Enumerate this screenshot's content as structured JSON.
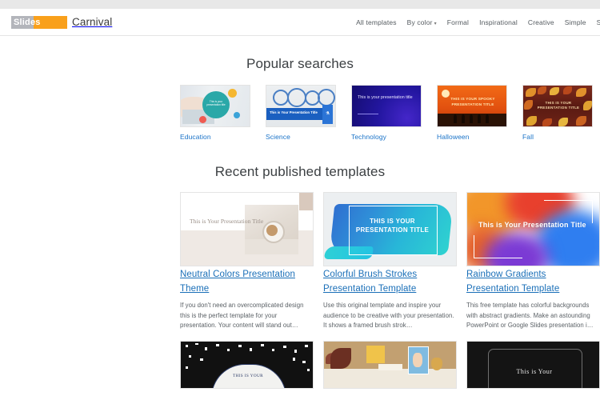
{
  "header": {
    "logo": {
      "mark_text": "Slides",
      "word": "Carnival"
    },
    "nav": [
      {
        "label": "All templates",
        "caret": ""
      },
      {
        "label": "By color",
        "caret": "▾"
      },
      {
        "label": "Formal",
        "caret": ""
      },
      {
        "label": "Inspirational",
        "caret": ""
      },
      {
        "label": "Creative",
        "caret": ""
      },
      {
        "label": "Simple",
        "caret": ""
      },
      {
        "label": "St",
        "caret": ""
      }
    ]
  },
  "popular": {
    "title": "Popular searches",
    "items": [
      {
        "label": "Education",
        "thumb_text": "This is your presentation title"
      },
      {
        "label": "Science",
        "thumb_text": "This is Your Presentation Title",
        "chip": "⚗"
      },
      {
        "label": "Technology",
        "thumb_text": "This is your presentation title"
      },
      {
        "label": "Halloween",
        "thumb_text": "THIS IS YOUR SPOOKY PRESENTATION TITLE"
      },
      {
        "label": "Fall",
        "thumb_text": "THIS IS YOUR PRESENTATION TITLE"
      }
    ]
  },
  "recent": {
    "title": "Recent published templates",
    "cards": [
      {
        "title": "Neutral Colors Presentation Theme",
        "desc": "If you don't need an overcomplicated design this is the perfect template for your presentation. Your content will stand out…",
        "thumb_text": "This is Your Presentation Title"
      },
      {
        "title": "Colorful Brush Strokes Presentation Template",
        "desc": "Use this original template and inspire your audience to be creative with your presentation. It shows a framed brush strok…",
        "thumb_text": "THIS IS YOUR PRESENTATION TITLE"
      },
      {
        "title": "Rainbow Gradients Presentation Template",
        "desc": "This free template has colorful backgrounds with abstract gradients. Make an astounding PowerPoint or Google Slides presentation i…",
        "thumb_text": "This is Your Presentation Title"
      }
    ],
    "partial_cards": [
      {
        "thumb_text": "THIS IS YOUR"
      },
      {
        "thumb_text": ""
      },
      {
        "thumb_text": "This is Your"
      }
    ]
  },
  "colors": {
    "link": "#1a6fb8",
    "brand_orange": "#f9a01b",
    "brand_grey": "#b3b5bb",
    "heading": "#3c4043"
  }
}
